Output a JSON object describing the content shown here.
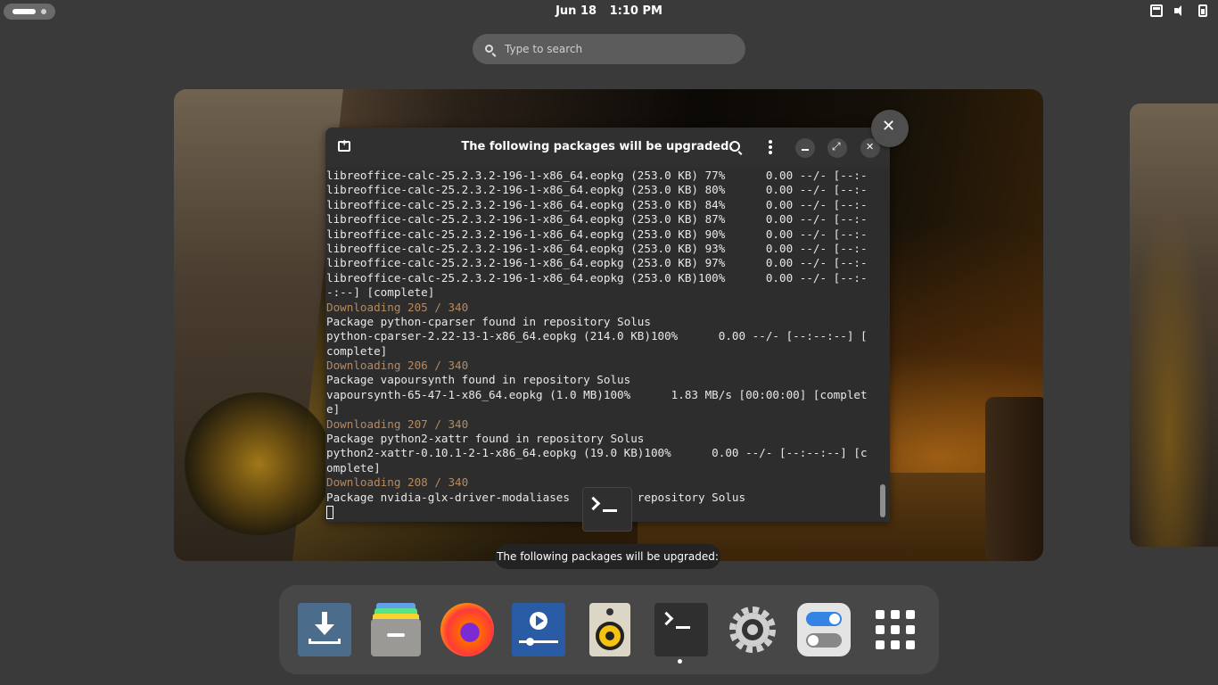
{
  "topbar": {
    "date": "Jun 18",
    "time": "1:10 PM"
  },
  "search": {
    "placeholder": "Type to search"
  },
  "terminal": {
    "title": "The following packages will be upgraded:",
    "lines": [
      {
        "text": "libreoffice-calc-25.2.3.2-196-1-x86_64.eopkg (253.0 KB) 77%      0.00 --/- [--:-",
        "type": "normal"
      },
      {
        "text": "libreoffice-calc-25.2.3.2-196-1-x86_64.eopkg (253.0 KB) 80%      0.00 --/- [--:-",
        "type": "normal"
      },
      {
        "text": "libreoffice-calc-25.2.3.2-196-1-x86_64.eopkg (253.0 KB) 84%      0.00 --/- [--:-",
        "type": "normal"
      },
      {
        "text": "libreoffice-calc-25.2.3.2-196-1-x86_64.eopkg (253.0 KB) 87%      0.00 --/- [--:-",
        "type": "normal"
      },
      {
        "text": "libreoffice-calc-25.2.3.2-196-1-x86_64.eopkg (253.0 KB) 90%      0.00 --/- [--:-",
        "type": "normal"
      },
      {
        "text": "libreoffice-calc-25.2.3.2-196-1-x86_64.eopkg (253.0 KB) 93%      0.00 --/- [--:-",
        "type": "normal"
      },
      {
        "text": "libreoffice-calc-25.2.3.2-196-1-x86_64.eopkg (253.0 KB) 97%      0.00 --/- [--:-",
        "type": "normal"
      },
      {
        "text": "libreoffice-calc-25.2.3.2-196-1-x86_64.eopkg (253.0 KB)100%      0.00 --/- [--:-",
        "type": "normal"
      },
      {
        "text": "-:--] [complete]",
        "type": "normal"
      },
      {
        "text": "Downloading 205 / 340",
        "type": "download"
      },
      {
        "text": "Package python-cparser found in repository Solus",
        "type": "normal"
      },
      {
        "text": "python-cparser-2.22-13-1-x86_64.eopkg (214.0 KB)100%      0.00 --/- [--:--:--] [",
        "type": "normal"
      },
      {
        "text": "complete]",
        "type": "normal"
      },
      {
        "text": "Downloading 206 / 340",
        "type": "download"
      },
      {
        "text": "Package vapoursynth found in repository Solus",
        "type": "normal"
      },
      {
        "text": "vapoursynth-65-47-1-x86_64.eopkg (1.0 MB)100%      1.83 MB/s [00:00:00] [complet",
        "type": "normal"
      },
      {
        "text": "e]",
        "type": "normal"
      },
      {
        "text": "Downloading 207 / 340",
        "type": "download"
      },
      {
        "text": "Package python2-xattr found in repository Solus",
        "type": "normal"
      },
      {
        "text": "python2-xattr-0.10.1-2-1-x86_64.eopkg (19.0 KB)100%      0.00 --/- [--:--:--] [c",
        "type": "normal"
      },
      {
        "text": "omplete]",
        "type": "normal"
      },
      {
        "text": "Downloading 208 / 340",
        "type": "download"
      },
      {
        "text": "Package nvidia-glx-driver-modaliases        n repository Solus",
        "type": "normal"
      }
    ]
  },
  "caption": "The following packages will be upgraded:",
  "dock": {
    "apps": [
      {
        "name": "downloads-app",
        "icon": "download-icon"
      },
      {
        "name": "files-app",
        "icon": "files-icon"
      },
      {
        "name": "firefox-app",
        "icon": "firefox-icon"
      },
      {
        "name": "video-app",
        "icon": "video-player-icon"
      },
      {
        "name": "rhythmbox-app",
        "icon": "speaker-icon"
      },
      {
        "name": "terminal-app",
        "icon": "terminal-icon"
      },
      {
        "name": "settings-app",
        "icon": "gear-icon"
      },
      {
        "name": "tweaks-app",
        "icon": "toggle-icon"
      },
      {
        "name": "show-apps",
        "icon": "app-grid-icon"
      }
    ]
  }
}
